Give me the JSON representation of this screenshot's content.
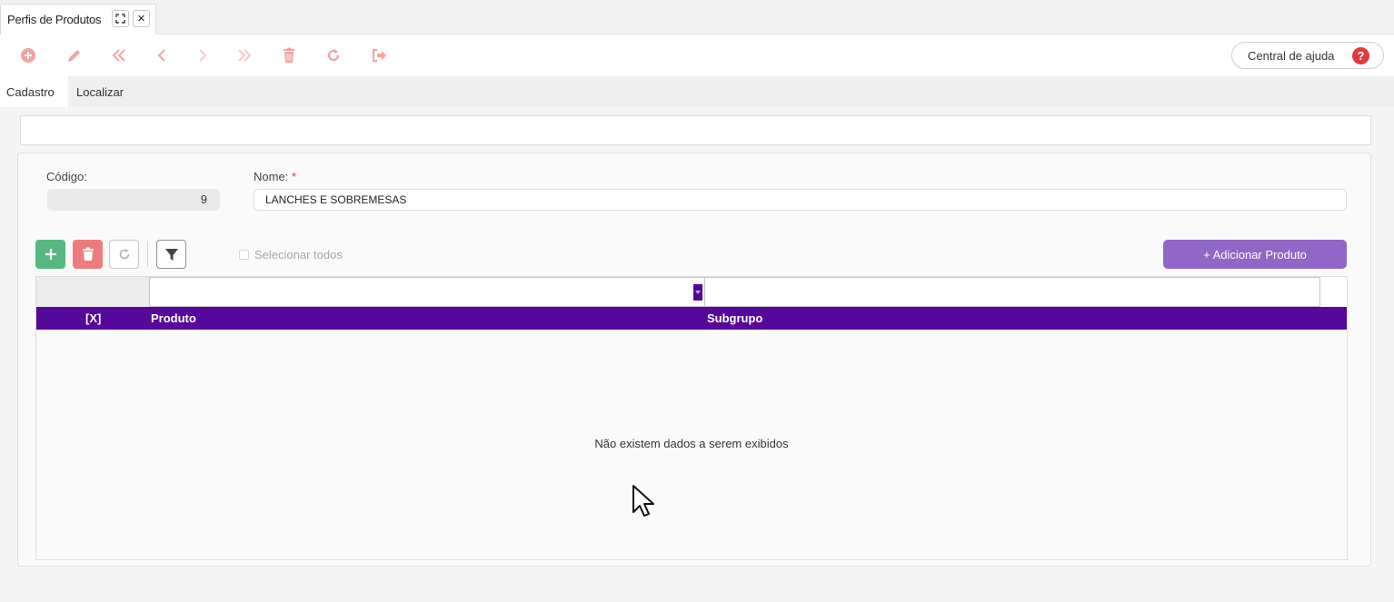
{
  "window": {
    "tab_title": "Perfis de Produtos",
    "maximize_glyph": "⛶",
    "close_glyph": "✕"
  },
  "toolbar": {
    "icons": [
      "add-circle-icon",
      "edit-pencil-icon",
      "first-record-icon",
      "previous-record-icon",
      "next-record-icon",
      "last-record-icon",
      "delete-trash-icon",
      "refresh-icon",
      "exit-icon"
    ],
    "help_label": "Central de ajuda",
    "help_glyph": "?"
  },
  "form_tabs": [
    {
      "label": "Cadastro",
      "active": true
    },
    {
      "label": "Localizar",
      "active": false
    }
  ],
  "form": {
    "codigo_label": "Código:",
    "codigo_value": "9",
    "nome_label": "Nome:",
    "nome_required_mark": "*",
    "nome_value": "LANCHES E SOBREMESAS"
  },
  "grid_toolbar": {
    "select_all_label": "Selecionar todos",
    "add_product_label": "+ Adicionar Produto"
  },
  "grid": {
    "columns": [
      "[X]",
      "Produto",
      "Subgrupo"
    ],
    "empty_message": "Não existem dados a serem exibidos"
  },
  "colors": {
    "header": "#55089a",
    "add_product": "#9066c6",
    "add_green": "#57b780",
    "delete_red": "#ef7c7c",
    "toolbar_icon": "#f2a3a3",
    "help_red": "#e03c3c"
  }
}
